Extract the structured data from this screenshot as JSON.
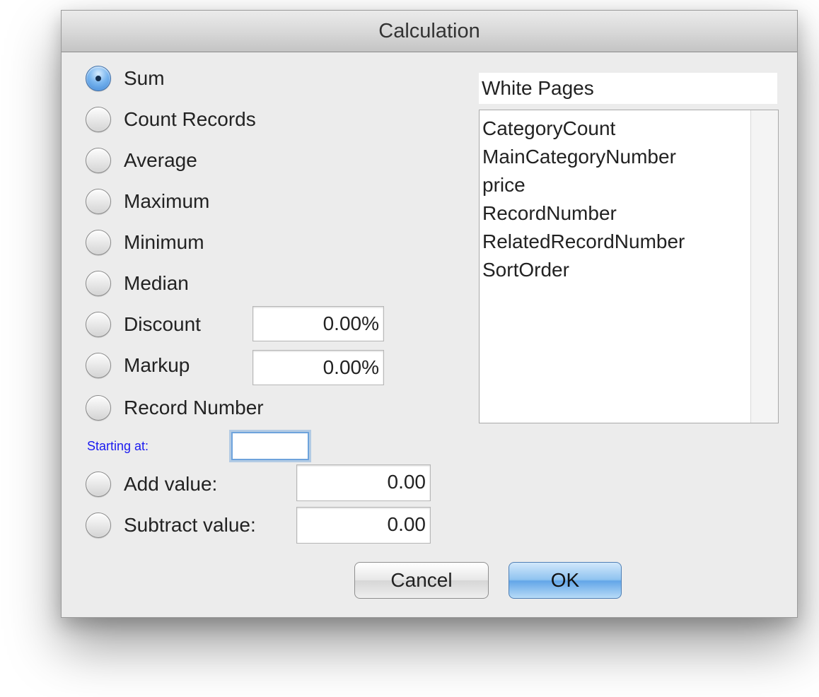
{
  "window": {
    "title": "Calculation"
  },
  "options": {
    "sum": "Sum",
    "count_records": "Count Records",
    "average": "Average",
    "maximum": "Maximum",
    "minimum": "Minimum",
    "median": "Median",
    "discount": "Discount",
    "markup": "Markup",
    "record_number": "Record Number",
    "add_value": "Add value:",
    "subtract_value": "Subtract value:",
    "selected": "Sum"
  },
  "fields": {
    "discount_value": "0.00%",
    "markup_value": "0.00%",
    "starting_at_label": "Starting at:",
    "starting_at_value": "",
    "add_value": "0.00",
    "subtract_value": "0.00"
  },
  "source": {
    "name": "White Pages",
    "fields": [
      "CategoryCount",
      "MainCategoryNumber",
      "price",
      "RecordNumber",
      "RelatedRecordNumber",
      "SortOrder"
    ]
  },
  "buttons": {
    "cancel": "Cancel",
    "ok": "OK"
  },
  "colors": {
    "accent": "#63a6e8",
    "starting_label": "#1a1af0"
  }
}
